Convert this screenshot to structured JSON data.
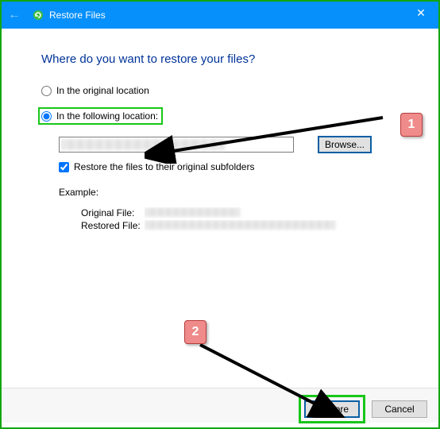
{
  "titlebar": {
    "title": "Restore Files"
  },
  "heading": "Where do you want to restore your files?",
  "options": {
    "original_label": "In the original location",
    "following_label": "In the following location:"
  },
  "path_value": "",
  "browse_label": "Browse...",
  "subfolders_label": "Restore the files to their original subfolders",
  "example": {
    "heading": "Example:",
    "original_key": "Original File:",
    "restored_key": "Restored File:"
  },
  "footer": {
    "restore": "Restore",
    "cancel": "Cancel"
  },
  "callouts": {
    "one": "1",
    "two": "2"
  }
}
